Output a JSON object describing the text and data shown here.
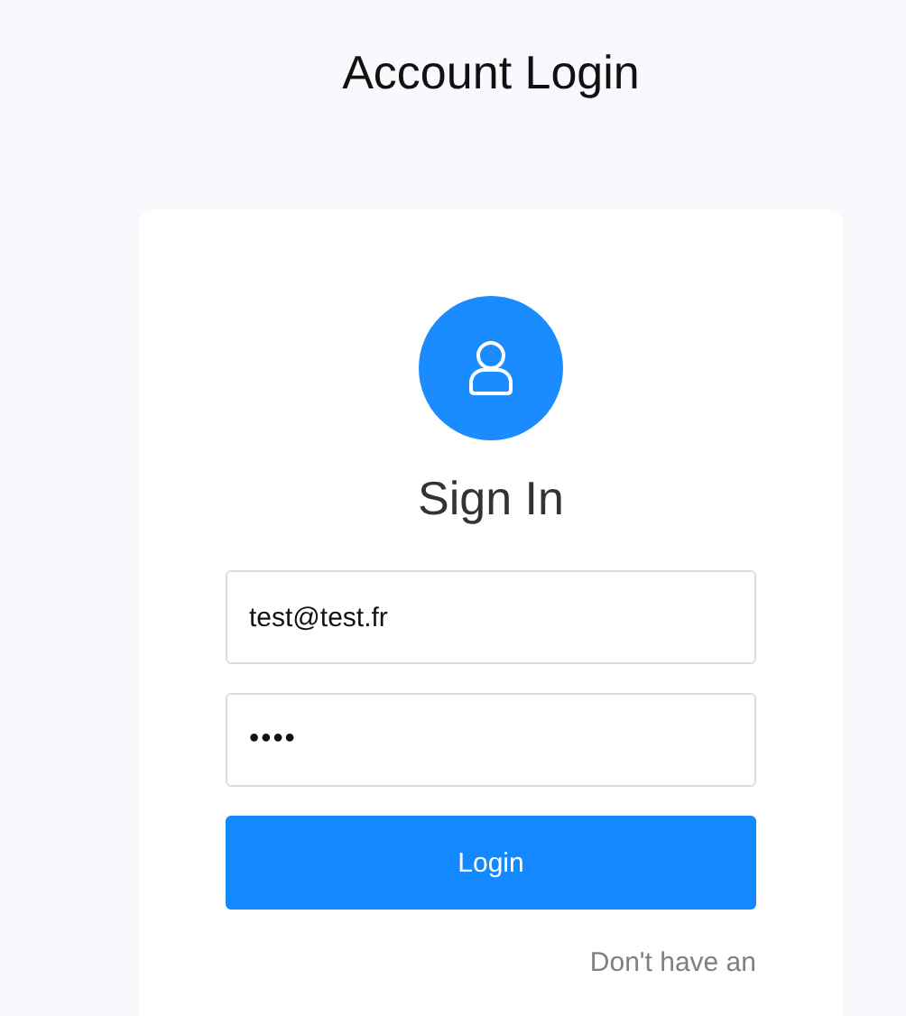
{
  "page_title": "Account Login",
  "card": {
    "heading": "Sign In",
    "email": {
      "value": "test@test.fr"
    },
    "password": {
      "value": "••••"
    },
    "login_button": "Login",
    "signup_prompt": "Don't have an"
  }
}
